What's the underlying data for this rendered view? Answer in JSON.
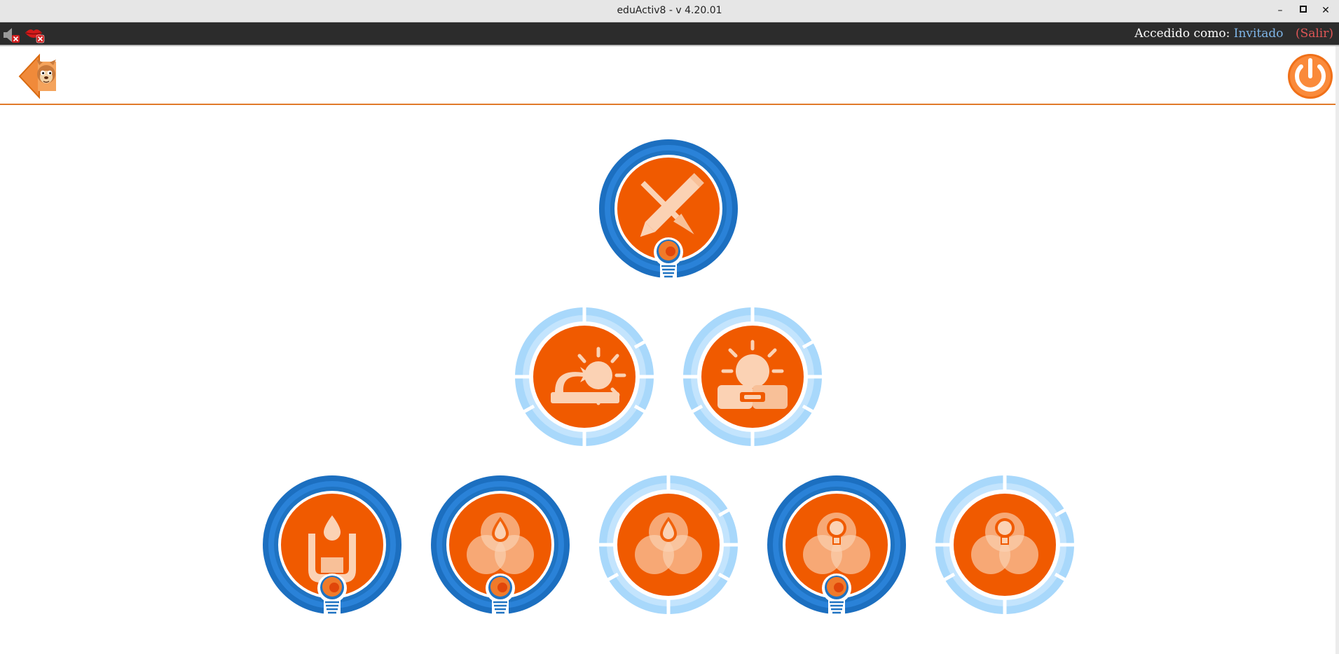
{
  "window": {
    "title": "eduActiv8 - v 4.20.01",
    "buttons": {
      "minimize": "–",
      "maximize": "▫",
      "close": "✕"
    }
  },
  "status": {
    "icons": [
      "speaker-muted-icon",
      "lips-muted-icon"
    ],
    "login_label": "Accedido como:",
    "user_name": "Invitado",
    "logout_label": "(Salir)"
  },
  "toolbar": {
    "back_icon": "back-arrow-mascot-icon",
    "power_icon": "power-icon"
  },
  "colors": {
    "accent_orange": "#f05a00",
    "dark_blue": "#1f73c2",
    "light_blue": "#a8d8fb",
    "status_bar": "#2c2c2c",
    "user_blue": "#7fb6e8",
    "logout_red": "#e05656"
  },
  "activities": [
    {
      "id": "art",
      "icon": "pencil-brush-icon",
      "ring": "dark",
      "bulb": true
    },
    {
      "id": "splash-move",
      "icon": "paint-splash-arrow-icon",
      "ring": "light",
      "bulb": false
    },
    {
      "id": "splash-link",
      "icon": "paint-splash-link-icon",
      "ring": "light",
      "bulb": false
    },
    {
      "id": "mix-drop",
      "icon": "beaker-drop-icon",
      "ring": "dark",
      "bulb": true
    },
    {
      "id": "venn-drop-1",
      "icon": "venn-drop-icon",
      "ring": "dark",
      "bulb": true
    },
    {
      "id": "venn-drop-2",
      "icon": "venn-drop-icon",
      "ring": "light",
      "bulb": false
    },
    {
      "id": "venn-bulb-1",
      "icon": "venn-bulb-icon",
      "ring": "dark",
      "bulb": true
    },
    {
      "id": "venn-bulb-2",
      "icon": "venn-bulb-icon",
      "ring": "light",
      "bulb": false
    }
  ]
}
